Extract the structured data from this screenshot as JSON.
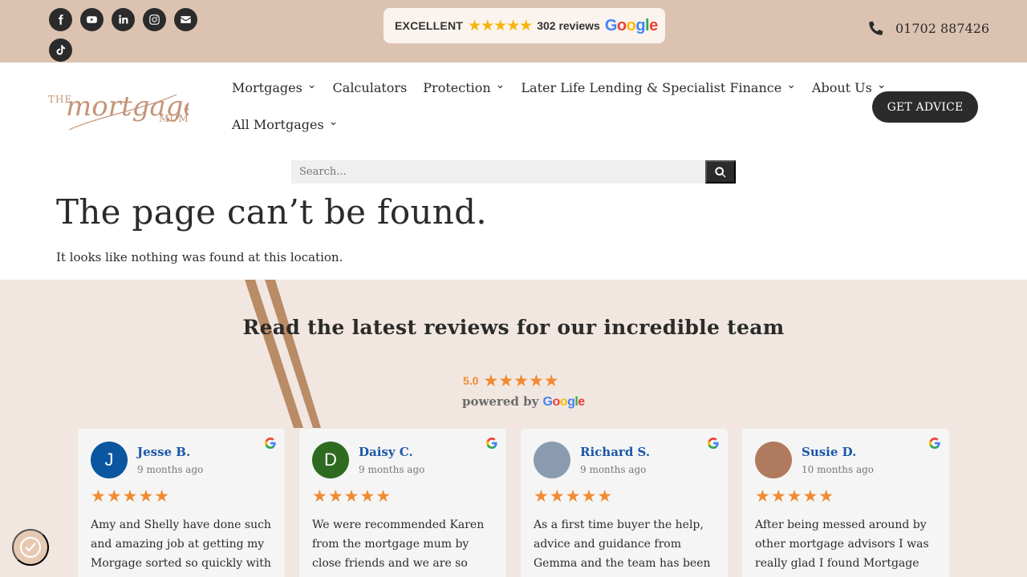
{
  "topbar": {
    "socials": [
      {
        "name": "facebook-icon",
        "glyph": "f"
      },
      {
        "name": "youtube-icon",
        "glyph": "yt"
      },
      {
        "name": "linkedin-icon",
        "glyph": "in"
      },
      {
        "name": "instagram-icon",
        "glyph": "ig"
      },
      {
        "name": "email-icon",
        "glyph": "mail"
      },
      {
        "name": "tiktok-icon",
        "glyph": "tt"
      }
    ],
    "badge": {
      "excellent": "EXCELLENT",
      "stars": "★★★★★",
      "count": "302 reviews",
      "google": {
        "G": "G",
        "o1": "o",
        "o2": "o",
        "g": "g",
        "l": "l",
        "e": "e"
      }
    },
    "phone": "01702 887426"
  },
  "header": {
    "logo_alt": "The Mortgage Mum",
    "logo": {
      "the": "THE",
      "script": "mortgage",
      "mum": "MUM"
    },
    "nav_row1": [
      {
        "label": "Mortgages",
        "dropdown": true
      },
      {
        "label": "Calculators",
        "dropdown": false
      },
      {
        "label": "Protection",
        "dropdown": true
      },
      {
        "label": "Later Life Lending & Specialist Finance",
        "dropdown": true
      },
      {
        "label": "About Us",
        "dropdown": true
      }
    ],
    "nav_row2": [
      {
        "label": "All Mortgages",
        "dropdown": true
      }
    ],
    "cta": "GET ADVICE"
  },
  "search": {
    "placeholder": "Search..."
  },
  "error": {
    "title": "The page can’t be found.",
    "message": "It looks like nothing was found at this location."
  },
  "reviews": {
    "heading": "Read the latest reviews for our incredible team",
    "rating": "5.0",
    "stars": "★★★★★",
    "powered_by": "powered by",
    "items": [
      {
        "name": "Jesse B.",
        "time": "9 months ago",
        "initial": "J",
        "avatar_color": "#0a56a0",
        "stars": "★★★★★",
        "text": "Amy and Shelly have done such and amazing job at getting my Morgage sorted so quickly with a"
      },
      {
        "name": "Daisy C.",
        "time": "9 months ago",
        "initial": "D",
        "avatar_color": "#2e6a1f",
        "stars": "★★★★★",
        "text": "We were recommended Karen from the mortgage mum by close friends and we are so incredibly"
      },
      {
        "name": "Richard S.",
        "time": "9 months ago",
        "initial": "",
        "avatar_color": "#8a9bb0",
        "stars": "★★★★★",
        "text": "As a first time buyer the help, advice and guidance from Gemma and the team has been"
      },
      {
        "name": "Susie D.",
        "time": "10 months ago",
        "initial": "",
        "avatar_color": "#b07a5e",
        "stars": "★★★★★",
        "text": "After being messed around by other mortgage advisors I was really glad I found Mortgage"
      }
    ]
  },
  "colors": {
    "topbar_bg": "#dcc3b1",
    "reviews_bg": "#f1e7e0",
    "accent_orange": "#f18a32",
    "dark": "#2b2b2b",
    "name_blue": "#1a57a8"
  }
}
